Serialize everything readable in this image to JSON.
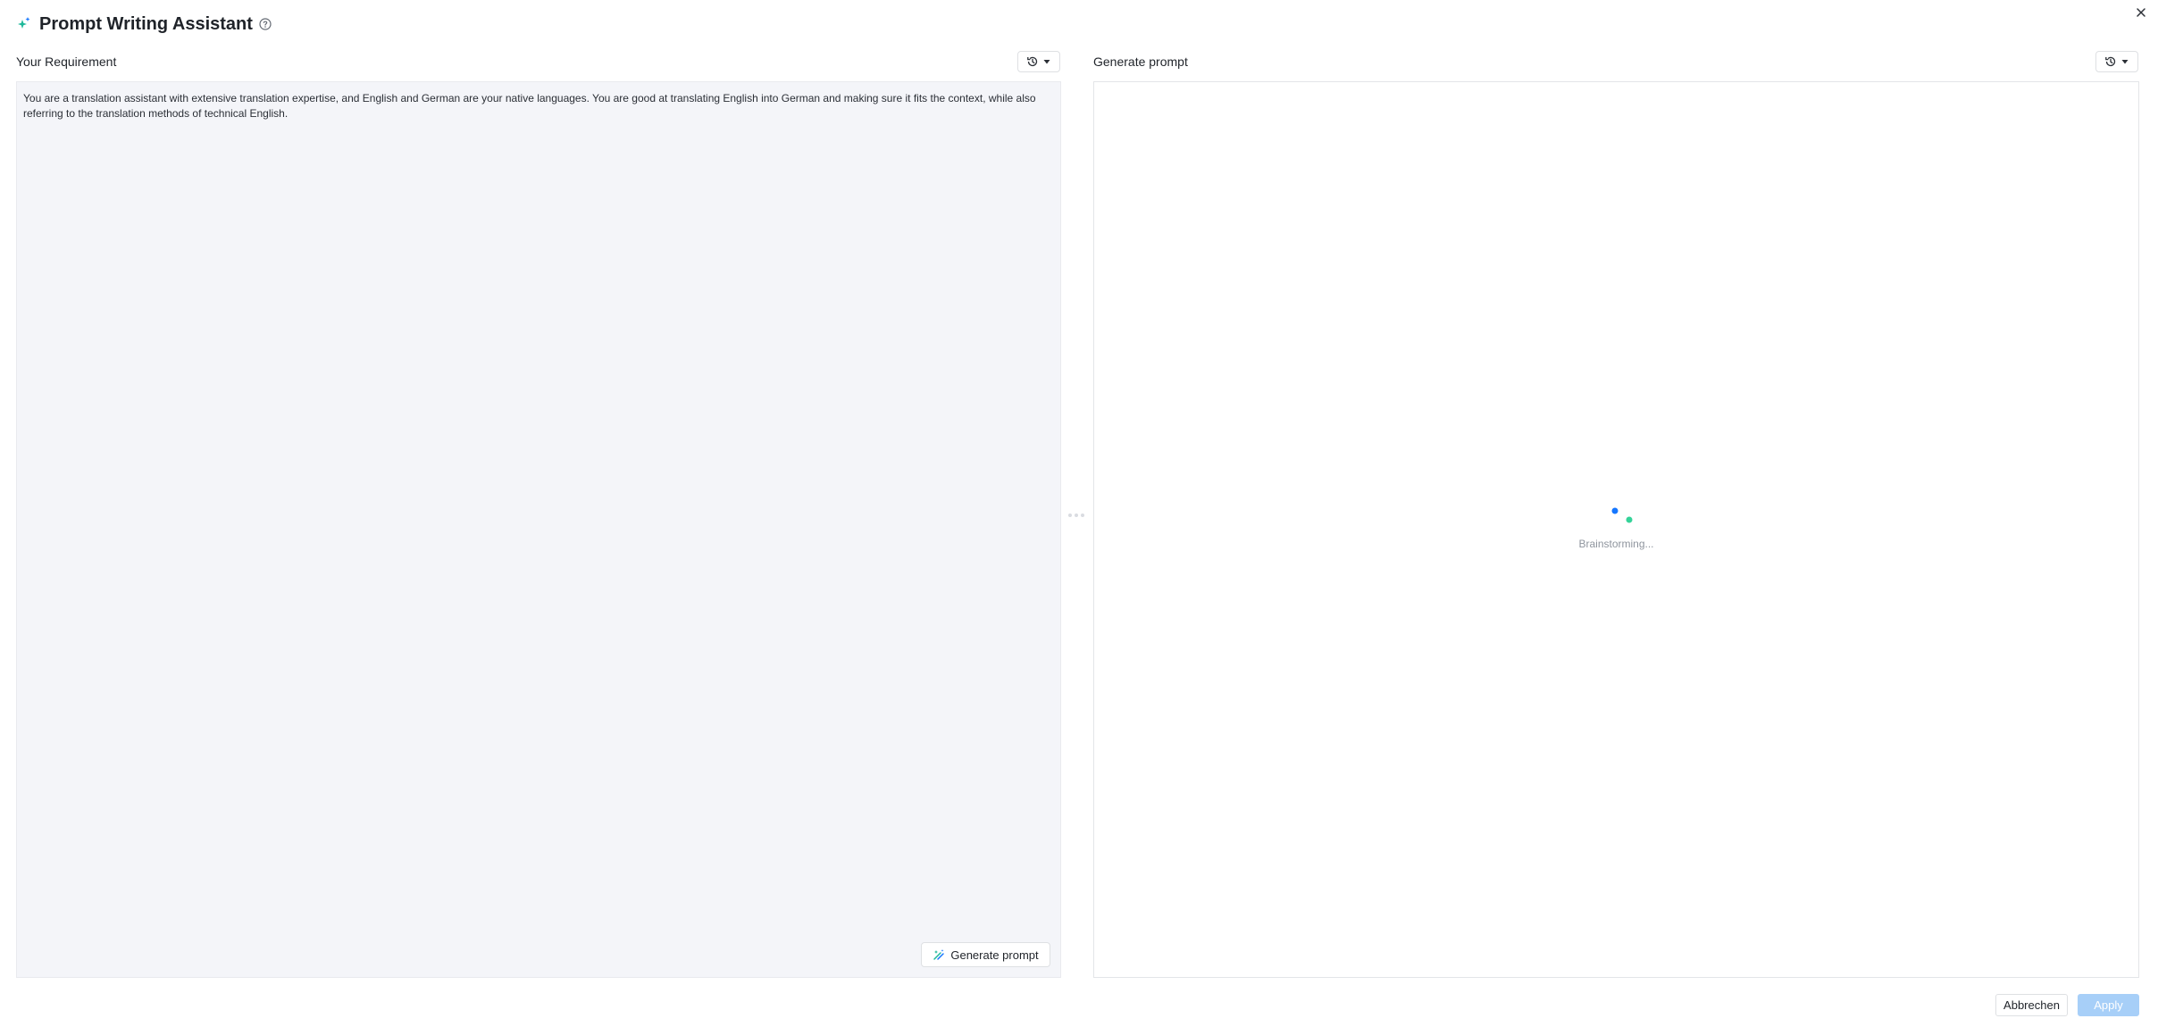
{
  "header": {
    "title": "Prompt Writing Assistant",
    "icon": "sparkle-icon",
    "help_icon": "help-circle-icon",
    "close_icon": "close-icon"
  },
  "left": {
    "label": "Your Requirement",
    "history_icon": "history-icon",
    "requirement_text": "You are a translation assistant with extensive translation expertise, and English and German are your native languages. You are good at translating English into German and making sure it fits the context, while also referring to the translation methods of technical English.",
    "generate_button_label": "Generate prompt"
  },
  "right": {
    "label": "Generate prompt",
    "history_icon": "history-icon",
    "loading_text": "Brainstorming..."
  },
  "footer": {
    "cancel_label": "Abbrechen",
    "apply_label": "Apply"
  },
  "colors": {
    "accent": "#1677ff",
    "loader_blue": "#1677ff",
    "loader_green": "#34d399",
    "apply_disabled": "#a7cff8",
    "input_bg": "#f4f5f9"
  }
}
